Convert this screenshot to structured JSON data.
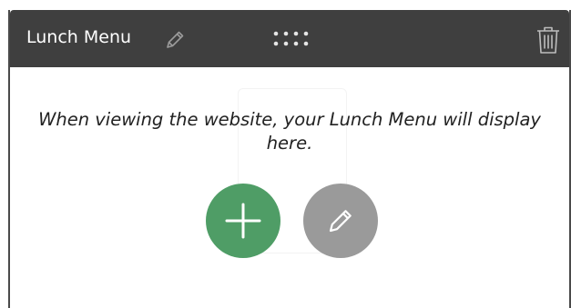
{
  "widget": {
    "title": "Lunch Menu",
    "message": "When viewing the website, your Lunch Menu will display here.",
    "icons": {
      "title_edit": "pencil-icon",
      "drag": "drag-dots-icon",
      "delete": "trash-icon",
      "add": "plus-icon",
      "edit": "pencil-icon"
    },
    "colors": {
      "header_bg": "#3f3f3f",
      "add_button": "#4f9d66",
      "edit_button": "#9a9a9a"
    }
  }
}
